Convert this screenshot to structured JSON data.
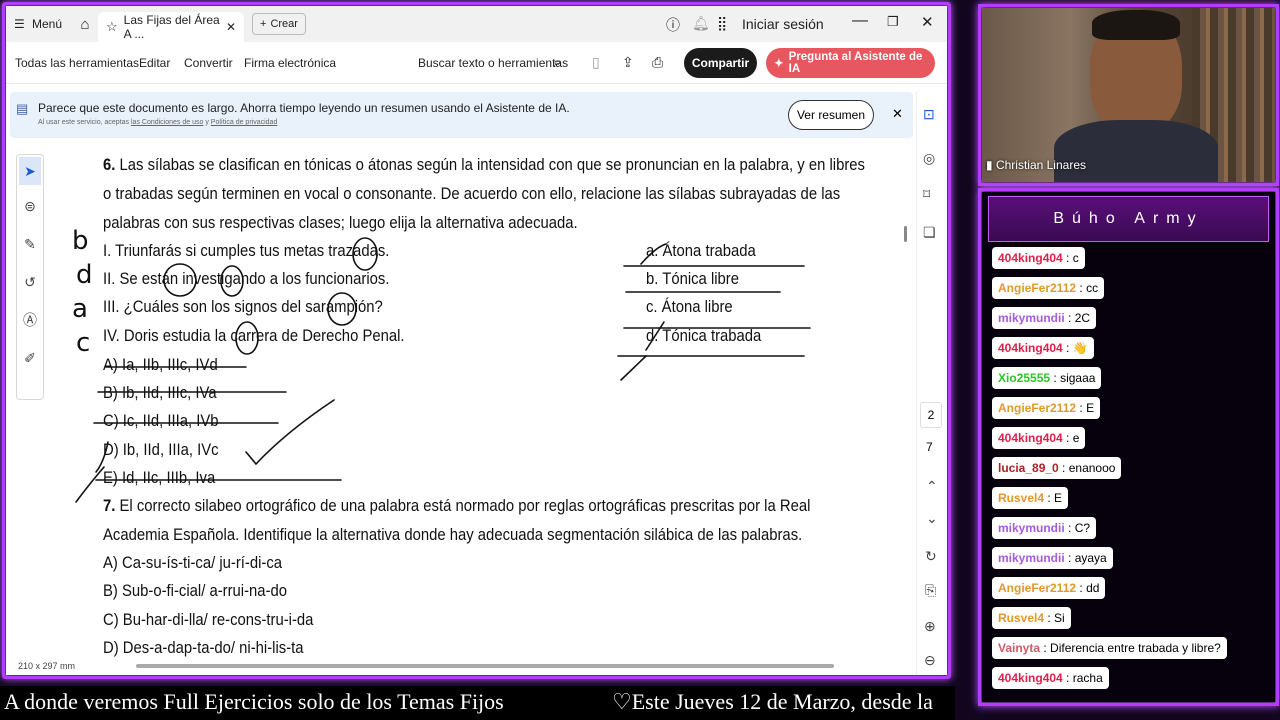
{
  "tabbar": {
    "menu_label": "Menú",
    "tab_title": "Las Fijas del Área A ...",
    "create_label": "Crear",
    "login_label": "Iniciar sesión"
  },
  "toolbar": {
    "all_tools": "Todas las herramientas",
    "edit": "Editar",
    "convert": "Convertir",
    "esign": "Firma electrónica",
    "search": "Buscar texto o herramientas",
    "share": "Compartir",
    "ai_assistant": "Pregunta al Asistente de IA"
  },
  "banner": {
    "text": "Parece que este documento es largo. Ahorra tiempo leyendo un resumen usando el Asistente de IA.",
    "fine_print_a": "Al usar este servicio, aceptas",
    "fine_print_terms": "las Condiciones de uso",
    "fine_print_and": "y",
    "fine_print_privacy": "Política de privacidad",
    "button": "Ver resumen"
  },
  "doc": {
    "q6_number": "6.",
    "q6_lines": [
      "Las sílabas se clasifican en tónicas o átonas según la intensidad con que se pronuncian en la palabra, y en libres",
      "o trabadas según terminen en vocal o consonante. De acuerdo con ello, relacione las sílabas subrayadas de las",
      "palabras con sus respectivas clases; luego elija la alternativa adecuada."
    ],
    "q6_items": [
      "I. Triunfarás si cumples tus metas trazadas.",
      "II. Se están investigando a los funcionarios.",
      "III. ¿Cuáles son los signos del sarampión?",
      "IV. Doris estudia la carrera de Derecho Penal."
    ],
    "q6_classes": [
      "a. Átona trabada",
      "b. Tónica libre",
      "c. Átona libre",
      "d. Tónica trabada"
    ],
    "q6_options": [
      "A) Ia, IIb, IIIc, IVd",
      "B) Ib, IId, IIIc, IVa",
      "C) Ic, IId, IIIa, IVb",
      "D) Ib, IId, IIIa, IVc",
      "E) Id, IIc, IIIb, Iva"
    ],
    "handwritten_marks": [
      "b",
      "d",
      "a",
      "c"
    ],
    "q7_number": "7.",
    "q7_lines": [
      "El correcto silabeo ortográfico de una palabra está normado por reglas ortográficas prescritas por la Real",
      "Academia Española. Identifique la alternativa donde hay adecuada segmentación silábica de las palabras."
    ],
    "q7_options": [
      "A) Ca-su-ís-ti-ca/ ju-rí-di-ca",
      "B) Sub-o-fi-cial/ a-rrui-na-do",
      "C) Bu-har-di-lla/ re-cons-tru-i-da",
      "D) Des-a-dap-ta-do/ ni-hi-lis-ta"
    ]
  },
  "right_panel": {
    "page_current": "2",
    "page_total": "7"
  },
  "status": {
    "page_size": "210 x 297 mm"
  },
  "webcam": {
    "name": "Christian Linares"
  },
  "chat": {
    "title": "Búho Army",
    "messages": [
      {
        "user": "404king404",
        "text": "c",
        "color": "#e0204a"
      },
      {
        "user": "AngieFer2112",
        "text": "cc",
        "color": "#e09a2a"
      },
      {
        "user": "mikymundii",
        "text": "2C",
        "color": "#a45ce0"
      },
      {
        "user": "404king404",
        "text": "👋",
        "color": "#e0204a"
      },
      {
        "user": "Xio25555",
        "text": "sigaaa",
        "color": "#2ec42e"
      },
      {
        "user": "AngieFer2112",
        "text": "E",
        "color": "#e09a2a"
      },
      {
        "user": "404king404",
        "text": "e",
        "color": "#e0204a"
      },
      {
        "user": "lucia_89_0",
        "text": "enanooo",
        "color": "#b0202a"
      },
      {
        "user": "Rusvel4",
        "text": "E",
        "color": "#e09a2a"
      },
      {
        "user": "mikymundii",
        "text": "C?",
        "color": "#a45ce0"
      },
      {
        "user": "mikymundii",
        "text": "ayaya",
        "color": "#a45ce0"
      },
      {
        "user": "AngieFer2112",
        "text": "dd",
        "color": "#e09a2a"
      },
      {
        "user": "Rusvel4",
        "text": "Si",
        "color": "#e09a2a"
      },
      {
        "user": "Vainyta",
        "text": "Diferencia entre trabada y libre?",
        "color": "#d05a6a"
      },
      {
        "user": "404king404",
        "text": "racha",
        "color": "#e0204a"
      }
    ]
  },
  "ticker": {
    "text_a": "A donde veremos Full Ejercicios solo de los Temas Fijos",
    "text_b": "♡Este Jueves 12 de Marzo, desde la"
  },
  "colors": {
    "frame": "#b33cff",
    "share": "#1b1b1b",
    "ai": "#e8565f",
    "banner": "#e9f1fb"
  }
}
